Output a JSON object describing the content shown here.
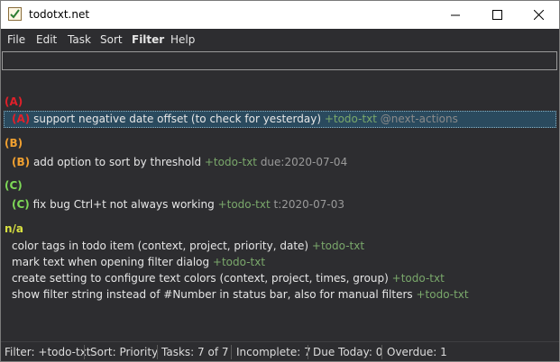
{
  "window": {
    "title": "todotxt.net"
  },
  "menu": {
    "items": [
      "File",
      "Edit",
      "Task",
      "Sort",
      "Filter",
      "Help"
    ]
  },
  "filter_input": {
    "value": ""
  },
  "groups": [
    {
      "header": "(A)",
      "color": "#e0202a",
      "tasks": [
        {
          "prio": "(A)",
          "text": " support negative date offset (to check for yesterday) ",
          "project": "+todo-txt",
          "extra": " @next-actions",
          "selected": true
        }
      ]
    },
    {
      "header": "(B)",
      "color": "#f0a030",
      "tasks": [
        {
          "prio": "(B)",
          "text": " add option to sort by threshold ",
          "project": "+todo-txt",
          "extra": " due:2020-07-04"
        }
      ]
    },
    {
      "header": "(C)",
      "color": "#7ed957",
      "tasks": [
        {
          "prio": "(C)",
          "text": " fix bug Ctrl+t not always working ",
          "project": "+todo-txt",
          "extra": " t:2020-07-03"
        }
      ]
    },
    {
      "header": "n/a",
      "color": "#d8e040",
      "tasks": [
        {
          "prio": "",
          "text": "color tags in todo item (context, project, priority, date) ",
          "project": "+todo-txt",
          "extra": ""
        },
        {
          "prio": "",
          "text": "mark text when opening filter dialog ",
          "project": "+todo-txt",
          "extra": ""
        },
        {
          "prio": "",
          "text": "create setting to configure text colors (context, project, times, group) ",
          "project": "+todo-txt",
          "extra": ""
        },
        {
          "prio": "",
          "text": "show filter string instead of #Number in status bar, also for manual filters ",
          "project": "+todo-txt",
          "extra": ""
        }
      ]
    }
  ],
  "status": {
    "filter_label": "Filter:",
    "filter_value": "+todo-txt",
    "sort_label": "Sort:",
    "sort_value": "Priority",
    "tasks_label": "Tasks:",
    "tasks_value": "7",
    "tasks_of": "of",
    "tasks_total": "7",
    "incomplete_label": "Incomplete:",
    "incomplete_value": "7",
    "due_label": "Due Today:",
    "due_value": "0",
    "overdue_label": "Overdue:",
    "overdue_value": "1"
  },
  "icons": {
    "app": "checkbox-notepad-icon",
    "minimize": "minimize-icon",
    "maximize": "maximize-icon",
    "close": "close-icon"
  }
}
